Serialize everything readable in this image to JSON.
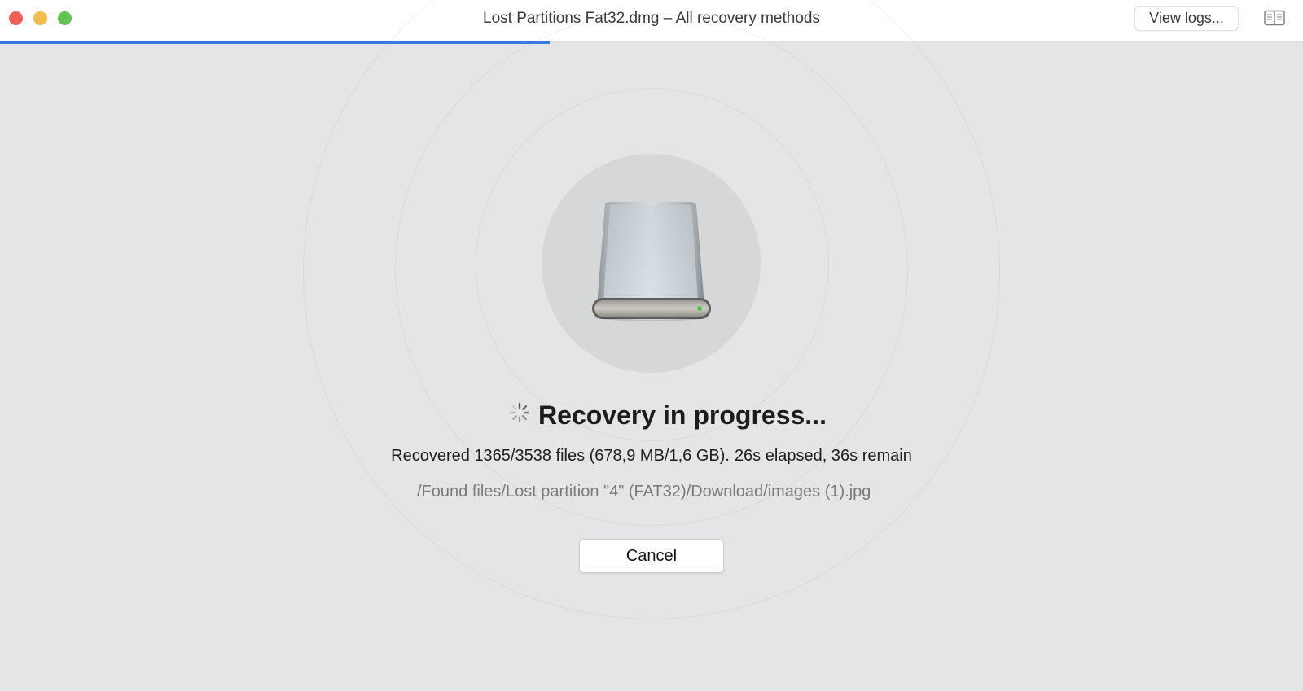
{
  "window": {
    "title": "Lost Partitions Fat32.dmg – All recovery methods",
    "view_logs_label": "View logs...",
    "sidebar_toggle_icon": "sidebar-icon",
    "traffic_lights": [
      "close",
      "minimize",
      "zoom"
    ]
  },
  "progress": {
    "fraction": 0.422,
    "color": "#3b7ae0"
  },
  "drive": {
    "icon": "external-drive-icon"
  },
  "status": {
    "spinner_icon": "spinner-icon",
    "title": "Recovery in progress...",
    "stats_files": "Recovered 1365/3538 files (678,9 MB/1,6 GB).",
    "stats_time": "26s elapsed, 36s remain",
    "current_path": "/Found files/Lost partition \"4\" (FAT32)/Download/images (1).jpg"
  },
  "actions": {
    "cancel_label": "Cancel"
  }
}
